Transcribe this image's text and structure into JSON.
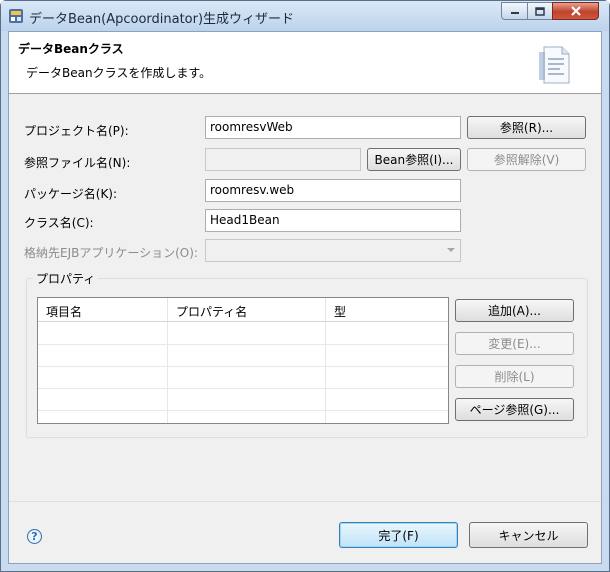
{
  "window": {
    "title": "データBean(Apcoordinator)生成ウィザード"
  },
  "header": {
    "title": "データBeanクラス",
    "description": "データBeanクラスを作成します。",
    "icon": "wizard-document-icon"
  },
  "form": {
    "project_label": "プロジェクト名(P):",
    "project_value": "roomresvWeb",
    "project_browse": "参照(R)...",
    "ref_file_label": "参照ファイル名(N):",
    "ref_file_value": "",
    "bean_ref_button": "Bean参照(I)...",
    "ref_clear_button": "参照解除(V)",
    "package_label": "パッケージ名(K):",
    "package_value": "roomresv.web",
    "class_label": "クラス名(C):",
    "class_value": "Head1Bean",
    "ejb_label": "格納先EJBアプリケーション(O):",
    "ejb_value": ""
  },
  "properties": {
    "group_title": "プロパティ",
    "columns": [
      "項目名",
      "プロパティ名",
      "型"
    ],
    "rows": [],
    "add_button": "追加(A)...",
    "edit_button": "変更(E)...",
    "delete_button": "削除(L)",
    "page_ref_button": "ページ参照(G)..."
  },
  "footer": {
    "help_icon": "help-icon",
    "finish_button": "完了(F)",
    "cancel_button": "キャンセル"
  },
  "colors": {
    "title_bar": "#c9dcef",
    "dialog_bg": "#f0f0f0",
    "close_button": "#c0432c",
    "default_button_border": "#3c7fb1"
  }
}
